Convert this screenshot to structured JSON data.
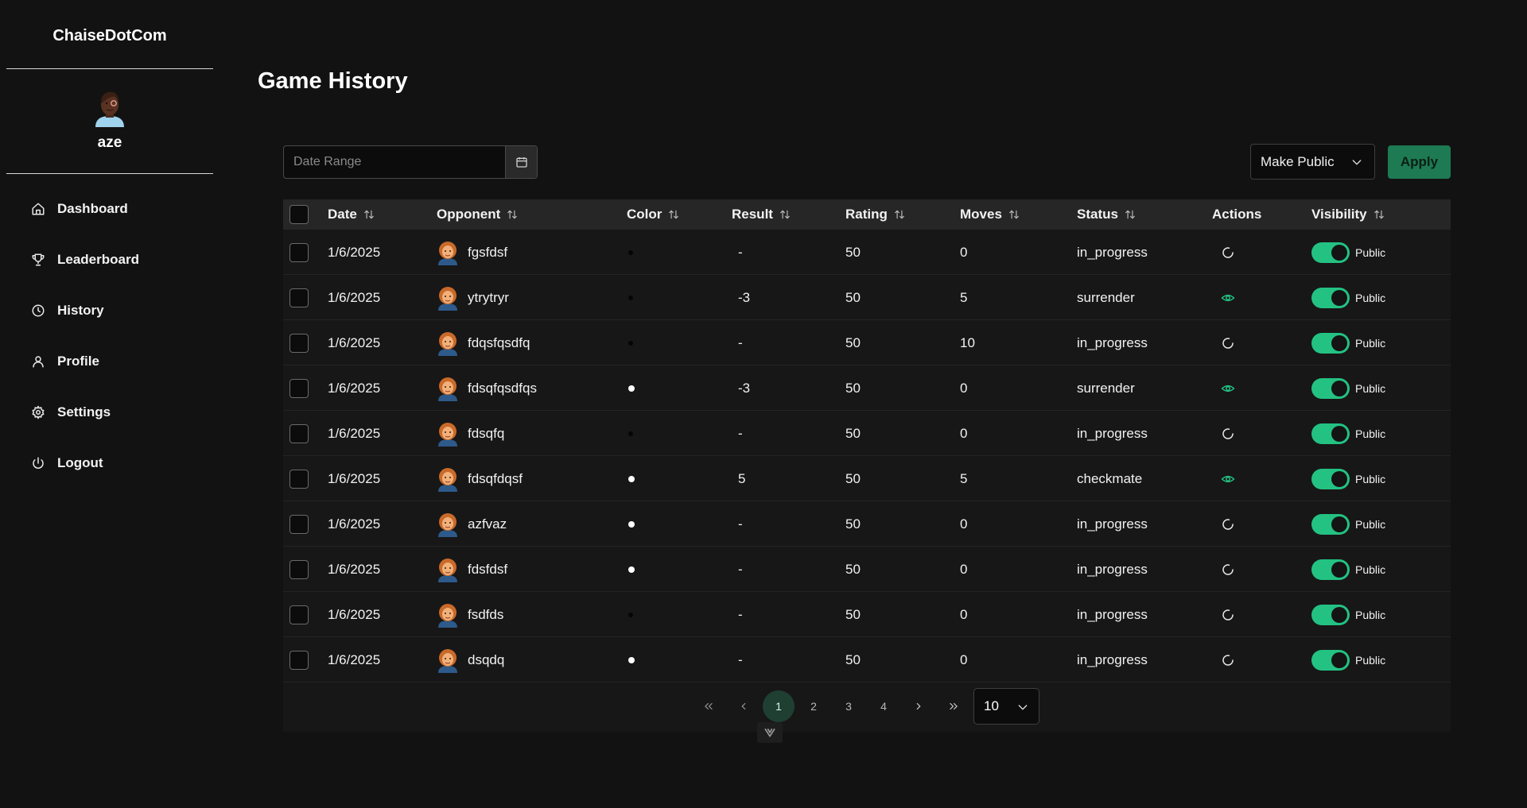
{
  "sidebar": {
    "brand": "ChaiseDotCom",
    "username": "aze",
    "items": [
      {
        "label": "Dashboard",
        "icon": "home-icon"
      },
      {
        "label": "Leaderboard",
        "icon": "trophy-icon"
      },
      {
        "label": "History",
        "icon": "clock-icon"
      },
      {
        "label": "Profile",
        "icon": "user-icon"
      },
      {
        "label": "Settings",
        "icon": "gear-icon"
      },
      {
        "label": "Logout",
        "icon": "power-icon"
      }
    ]
  },
  "page": {
    "title": "Game History"
  },
  "filters": {
    "date_placeholder": "Date Range",
    "visibility_action": "Make Public",
    "apply_label": "Apply"
  },
  "table": {
    "headers": {
      "date": "Date",
      "opponent": "Opponent",
      "color": "Color",
      "result": "Result",
      "rating": "Rating",
      "moves": "Moves",
      "status": "Status",
      "actions": "Actions",
      "visibility": "Visibility"
    },
    "rows": [
      {
        "date": "1/6/2025",
        "opponent": "fgsfdsf",
        "color": "black",
        "result": "-",
        "rating": "50",
        "moves": "0",
        "status": "in_progress",
        "action": "loading-icon",
        "visibility": "Public"
      },
      {
        "date": "1/6/2025",
        "opponent": "ytrytryr",
        "color": "black",
        "result": "-3",
        "rating": "50",
        "moves": "5",
        "status": "surrender",
        "action": "eye-icon",
        "visibility": "Public"
      },
      {
        "date": "1/6/2025",
        "opponent": "fdqsfqsdfq",
        "color": "black",
        "result": "-",
        "rating": "50",
        "moves": "10",
        "status": "in_progress",
        "action": "loading-icon",
        "visibility": "Public"
      },
      {
        "date": "1/6/2025",
        "opponent": "fdsqfqsdfqs",
        "color": "white",
        "result": "-3",
        "rating": "50",
        "moves": "0",
        "status": "surrender",
        "action": "eye-icon",
        "visibility": "Public"
      },
      {
        "date": "1/6/2025",
        "opponent": "fdsqfq",
        "color": "black",
        "result": "-",
        "rating": "50",
        "moves": "0",
        "status": "in_progress",
        "action": "loading-icon",
        "visibility": "Public"
      },
      {
        "date": "1/6/2025",
        "opponent": "fdsqfdqsf",
        "color": "white",
        "result": "5",
        "rating": "50",
        "moves": "5",
        "status": "checkmate",
        "action": "eye-icon",
        "visibility": "Public"
      },
      {
        "date": "1/6/2025",
        "opponent": "azfvaz",
        "color": "white",
        "result": "-",
        "rating": "50",
        "moves": "0",
        "status": "in_progress",
        "action": "loading-icon",
        "visibility": "Public"
      },
      {
        "date": "1/6/2025",
        "opponent": "fdsfdsf",
        "color": "white",
        "result": "-",
        "rating": "50",
        "moves": "0",
        "status": "in_progress",
        "action": "loading-icon",
        "visibility": "Public"
      },
      {
        "date": "1/6/2025",
        "opponent": "fsdfds",
        "color": "black",
        "result": "-",
        "rating": "50",
        "moves": "0",
        "status": "in_progress",
        "action": "loading-icon",
        "visibility": "Public"
      },
      {
        "date": "1/6/2025",
        "opponent": "dsqdq",
        "color": "white",
        "result": "-",
        "rating": "50",
        "moves": "0",
        "status": "in_progress",
        "action": "loading-icon",
        "visibility": "Public"
      }
    ]
  },
  "pagination": {
    "pages": [
      "1",
      "2",
      "3",
      "4"
    ],
    "current_page": "1",
    "rows_per_page": "10"
  },
  "colors": {
    "accent": "#23c283",
    "apply_bg": "#1d7a53",
    "background": "#121212",
    "table_header": "#262626"
  }
}
